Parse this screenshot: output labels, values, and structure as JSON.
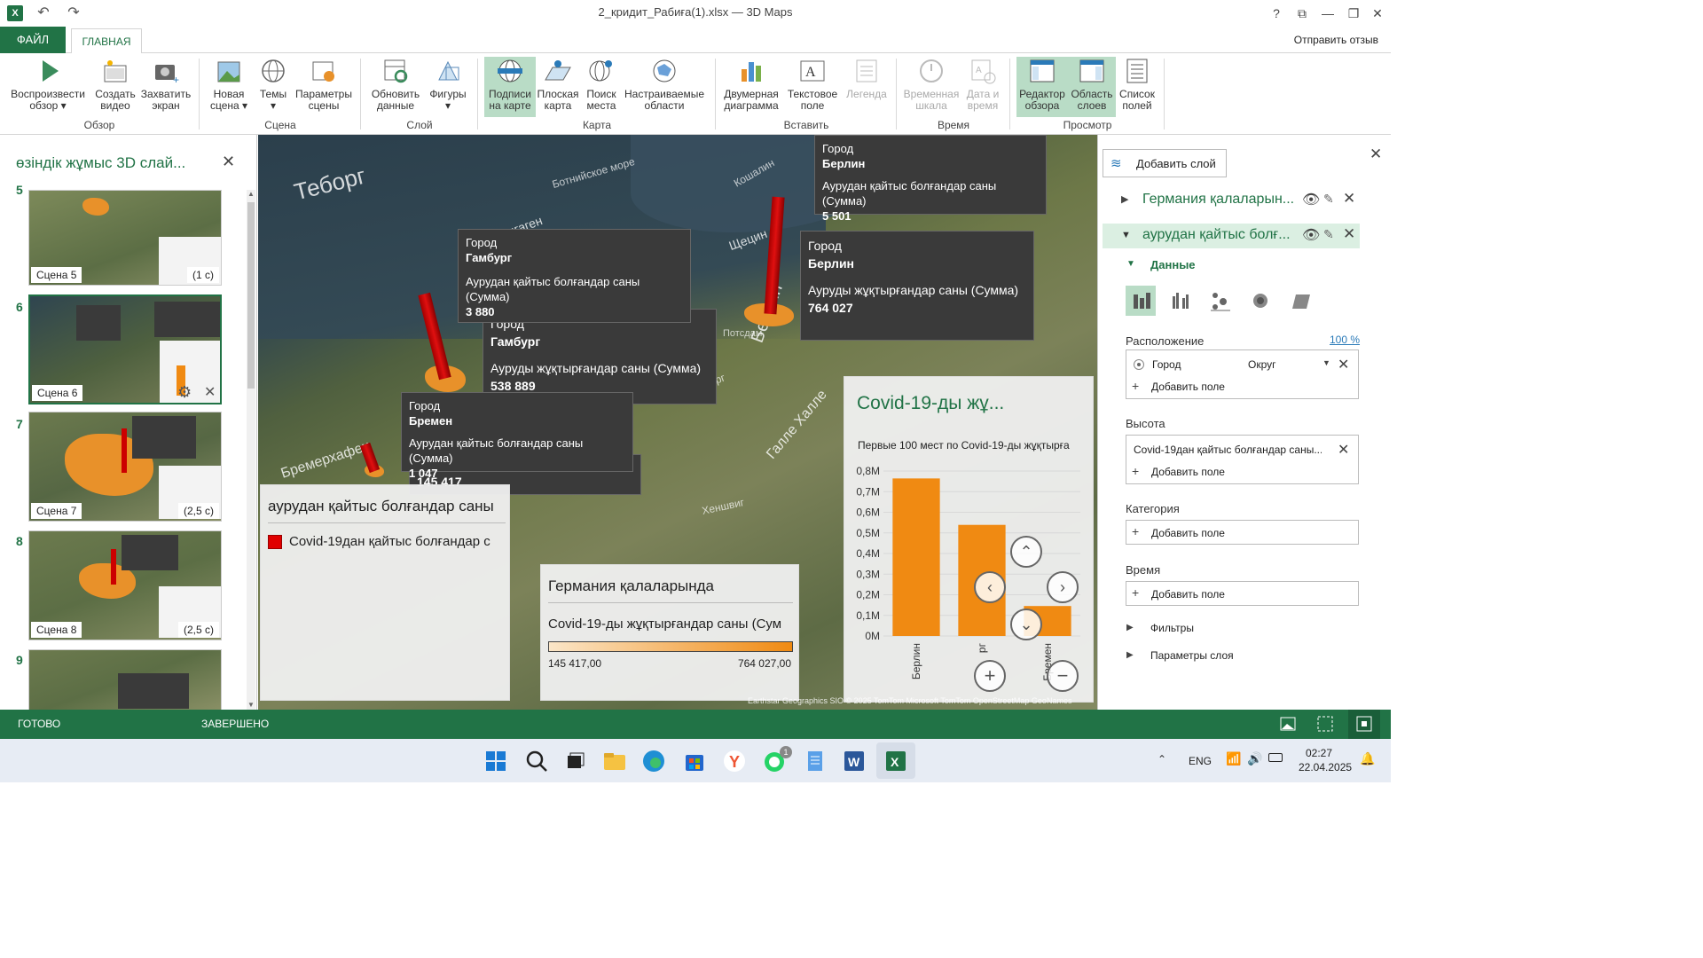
{
  "window": {
    "title": "2_кридит_Рабиға(1).xlsx — 3D Maps"
  },
  "tabs": {
    "file": "ФАЙЛ",
    "home": "ГЛАВНАЯ",
    "feedback": "Отправить отзыв"
  },
  "ribbon": {
    "buttons": [
      {
        "l1": "Воспроизвести",
        "l2": "обзор ▾"
      },
      {
        "l1": "Создать",
        "l2": "видео"
      },
      {
        "l1": "Захватить",
        "l2": "экран"
      },
      {
        "l1": "Новая",
        "l2": "сцена ▾"
      },
      {
        "l1": "Темы",
        "l2": "▾"
      },
      {
        "l1": "Параметры",
        "l2": "сцены"
      },
      {
        "l1": "Обновить",
        "l2": "данные"
      },
      {
        "l1": "Фигуры",
        "l2": "▾"
      },
      {
        "l1": "Подписи",
        "l2": "на карте"
      },
      {
        "l1": "Плоская",
        "l2": "карта"
      },
      {
        "l1": "Поиск",
        "l2": "места"
      },
      {
        "l1": "Настраиваемые",
        "l2": "области"
      },
      {
        "l1": "Двумерная",
        "l2": "диаграмма"
      },
      {
        "l1": "Текстовое",
        "l2": "поле"
      },
      {
        "l1": "Легенда",
        "l2": ""
      },
      {
        "l1": "Временная",
        "l2": "шкала"
      },
      {
        "l1": "Дата и",
        "l2": "время"
      },
      {
        "l1": "Редактор",
        "l2": "обзора"
      },
      {
        "l1": "Область",
        "l2": "слоев"
      },
      {
        "l1": "Список",
        "l2": "полей"
      }
    ],
    "groups": [
      "Обзор",
      "Сцена",
      "Слой",
      "Карта",
      "Вставить",
      "Время",
      "Просмотр"
    ]
  },
  "tour": {
    "title": "өзіндік жұмыс 3D слай...",
    "scenes": [
      {
        "num": "5",
        "name": "Сцена 5",
        "dur": "(1 с)"
      },
      {
        "num": "6",
        "name": "Сцена 6",
        "dur": ""
      },
      {
        "num": "7",
        "name": "Сцена 7",
        "dur": "(2,5 с)"
      },
      {
        "num": "8",
        "name": "Сцена 8",
        "dur": "(2,5 с)"
      },
      {
        "num": "9",
        "name": "",
        "dur": ""
      }
    ]
  },
  "map": {
    "labels": [
      "Теборг",
      "Копенгаген",
      "Ботнийское море",
      "Щецин",
      "Берлин",
      "Потсдам",
      "Бремерхафен",
      "Бремен",
      "Галле Халле",
      "Магдебург",
      "Хеншвиг",
      "Кошалин"
    ],
    "tooltips": [
      {
        "k": "Город",
        "city": "Берлин",
        "metric": "Аурудан қайтыс болғандар саны (Сумма)",
        "value": "5 501"
      },
      {
        "k": "Город",
        "city": "Берлин",
        "metric": "Ауруды жұқтырғандар саны (Сумма)",
        "value": "764 027"
      },
      {
        "k": "Город",
        "city": "Гамбург",
        "metric": "Аурудан қайтыс болғандар саны (Сумма)",
        "value": "3 880"
      },
      {
        "k": "Город",
        "city": "Гамбург",
        "metric": "Ауруды жұқтырғандар саны (Сумма)",
        "value": "538 889"
      },
      {
        "k": "Город",
        "city": "Бремен",
        "metric": "Аурудан қайтыс болғандар саны (Сумма)",
        "value": "1 047"
      }
    ],
    "partial_value": "145 417",
    "legend1": {
      "title": "аурудан қайтыс болғандар саны",
      "item": "Covid-19дан қайтыс болғандар с",
      "color": "#e00000"
    },
    "legend2": {
      "title": "Германия қалаларында",
      "subtitle": "Covid-19-ды жұқтырғандар саны (Сум",
      "min": "145 417,00",
      "max": "764 027,00"
    },
    "copyright": "Earthstar Geographics  SIO  © 2025 TomTom  Microsoft  TomTom  OpenStreetMap  GeoNames"
  },
  "chart_data": {
    "type": "bar",
    "title": "Covid-19-ды жұ...",
    "subtitle": "Первые 100 мест  по Covid-19-ды жұқтырға",
    "categories": [
      "Берлин",
      "Гамбург",
      "Бремен"
    ],
    "category_labels_visible": [
      "Берлин",
      "рг",
      "Бремен"
    ],
    "values": [
      764027,
      538889,
      145417
    ],
    "ylim": [
      0,
      800000
    ],
    "yticks": [
      "0М",
      "0,1М",
      "0,2М",
      "0,3М",
      "0,4М",
      "0,5М",
      "0,6М",
      "0,7М",
      "0,8М"
    ],
    "color": "#f08a12",
    "grid": true
  },
  "layers": {
    "add_button": "Добавить слой",
    "items": [
      {
        "name": "Германия қалаларын..."
      },
      {
        "name": "аурудан қайтыс болғ..."
      }
    ],
    "data_header": "Данные",
    "location_label": "Расположение",
    "location_pct": "100 %",
    "location_field": "Город",
    "location_type": "Округ",
    "add_field": "Добавить поле",
    "height_label": "Высота",
    "height_field": "Covid-19дан қайтыс болғандар саны...",
    "category_label": "Категория",
    "time_label": "Время",
    "filters": "Фильтры",
    "layer_options": "Параметры слоя"
  },
  "status": {
    "ready": "ГОТОВО",
    "done": "ЗАВЕРШЕНО"
  },
  "taskbar": {
    "lang": "ENG",
    "time": "02:27",
    "date": "22.04.2025",
    "whatsapp_badge": "1"
  }
}
